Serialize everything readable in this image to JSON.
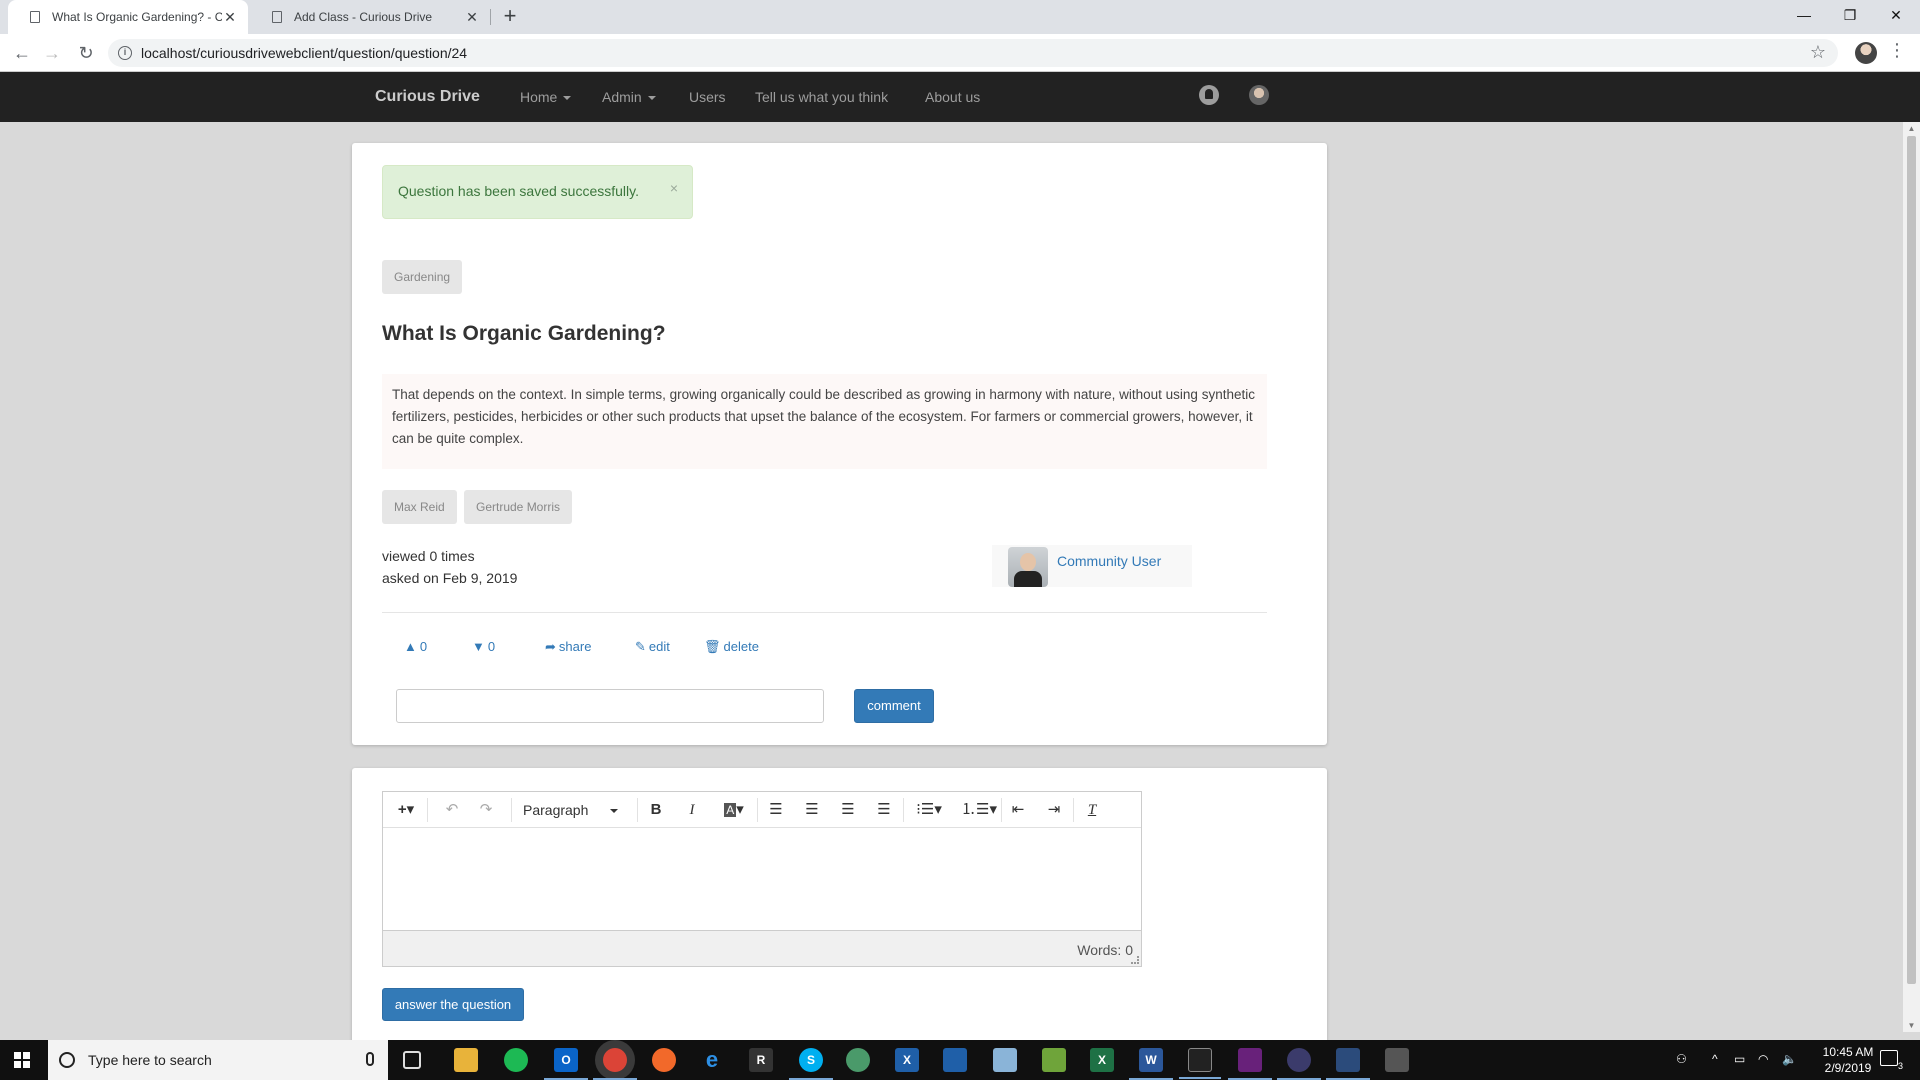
{
  "browser": {
    "tabs": [
      {
        "title": "What Is Organic Gardening? - Cu",
        "active": true
      },
      {
        "title": "Add Class - Curious Drive",
        "active": false
      }
    ],
    "url": "localhost/curiousdrivewebclient/question/question/24"
  },
  "navbar": {
    "brand": "Curious Drive",
    "items": [
      "Home",
      "Admin",
      "Users",
      "Tell us what you think",
      "About us"
    ]
  },
  "alert": {
    "message": "Question has been saved successfully.",
    "close": "×"
  },
  "question": {
    "category": "Gardening",
    "title": "What Is Organic Gardening?",
    "body": "That depends on the context. In simple terms, growing organically could be described as growing in harmony with nature, without using synthetic fertilizers, pesticides, herbicides or other such products that upset the balance of the ecosystem. For farmers or commercial growers, however, it can be quite complex.",
    "tags": [
      "Max Reid",
      "Gertrude Morris"
    ],
    "viewed": "viewed 0 times",
    "asked": "asked on Feb 9, 2019",
    "asker": "Community User",
    "upvotes": "0",
    "downvotes": "0",
    "actions": {
      "share": "share",
      "edit": "edit",
      "delete": "delete"
    },
    "comment_button": "comment",
    "comment_value": ""
  },
  "editor": {
    "format": "Paragraph",
    "word_count": "Words: 0",
    "submit": "answer the question"
  },
  "taskbar": {
    "search_placeholder": "Type here to search",
    "time": "10:45 AM",
    "date": "2/9/2019",
    "notifications": "3"
  }
}
